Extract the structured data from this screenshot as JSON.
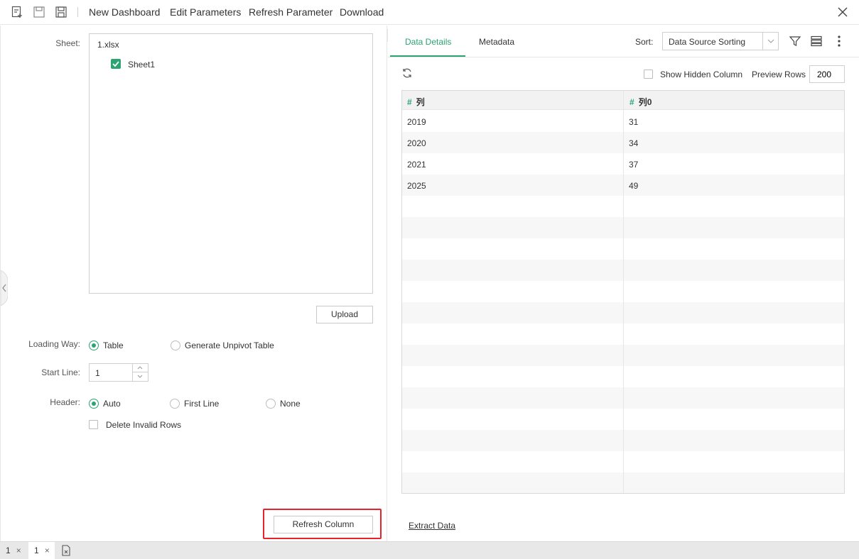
{
  "toolbar": {
    "menus": [
      "New Dashboard",
      "Edit Parameters",
      "Refresh Parameter",
      "Download"
    ],
    "icons": [
      "new-page-icon",
      "save-icon",
      "save-as-icon",
      "close-icon"
    ]
  },
  "left": {
    "sheet_label": "Sheet:",
    "file_name": "1.xlsx",
    "sheet_item": "Sheet1",
    "sheet_checked": true,
    "upload_label": "Upload",
    "loading_way": {
      "label": "Loading Way:",
      "options": [
        "Table",
        "Generate Unpivot Table"
      ],
      "selected": "Table"
    },
    "start_line": {
      "label": "Start Line:",
      "value": "1"
    },
    "header": {
      "label": "Header:",
      "options": [
        "Auto",
        "First Line",
        "None"
      ],
      "selected": "Auto"
    },
    "delete_invalid_rows": {
      "label": "Delete Invalid Rows",
      "checked": false
    },
    "refresh_column_label": "Refresh Column"
  },
  "right": {
    "tabs": [
      "Data Details",
      "Metadata"
    ],
    "active_tab": "Data Details",
    "sort": {
      "label": "Sort:",
      "value": "Data Source Sorting"
    },
    "show_hidden_column": {
      "label": "Show Hidden Column",
      "checked": false
    },
    "preview_rows": {
      "label": "Preview Rows",
      "value": "200"
    },
    "table": {
      "columns": [
        "列",
        "列0"
      ],
      "rows": [
        [
          "2019",
          "31"
        ],
        [
          "2020",
          "34"
        ],
        [
          "2021",
          "37"
        ],
        [
          "2025",
          "49"
        ]
      ]
    },
    "extract_label": "Extract Data"
  },
  "bottom_tabs": [
    {
      "label": "1",
      "active": false
    },
    {
      "label": "1",
      "active": true
    }
  ],
  "colors": {
    "accent": "#2ba471",
    "highlight": "#e8242b"
  }
}
